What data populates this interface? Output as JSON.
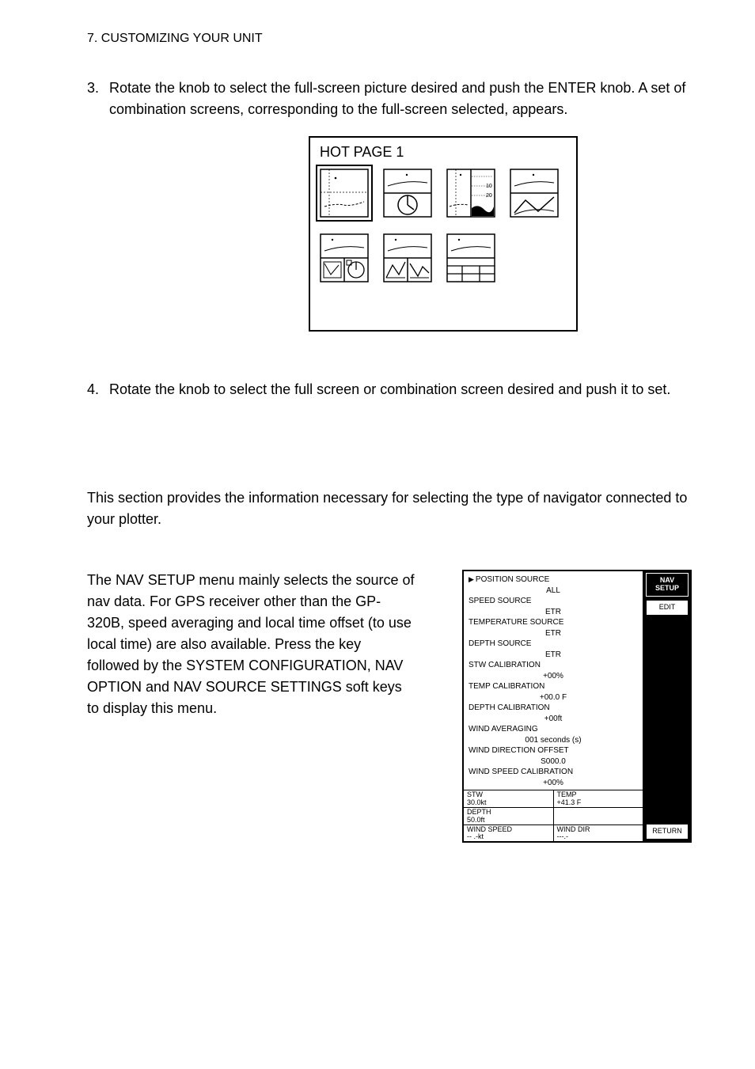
{
  "header": "7. CUSTOMIZING YOUR UNIT",
  "step3": {
    "num": "3.",
    "text": "Rotate the             knob to select the full-screen picture desired and push the ENTER knob. A set of combination screens, corresponding to the full-screen selected, appears."
  },
  "hotpage": {
    "title": "HOT PAGE 1",
    "thumb3_labels": {
      "ten": "10",
      "twenty": "20"
    }
  },
  "step4": {
    "num": "4.",
    "text": "Rotate the             knob to select the full screen or combination screen desired and push it to set."
  },
  "section_intro": "This section provides the information necessary for selecting the type of navigator connected to your plotter.",
  "nav_text": "The NAV SETUP menu mainly selects the source of nav data. For GPS receiver other than the GP-320B, speed averaging and local time offset (to use local time) are also available. Press the          key followed by the SYSTEM CONFIGURATION, NAV OPTION and NAV SOURCE SETTINGS soft keys to display this menu.",
  "nav_panel": {
    "items": [
      {
        "label": "POSITION SOURCE",
        "value": "ALL",
        "pointer": true
      },
      {
        "label": "SPEED SOURCE",
        "value": "ETR"
      },
      {
        "label": "TEMPERATURE SOURCE",
        "value": "ETR"
      },
      {
        "label": "DEPTH SOURCE",
        "value": "ETR"
      },
      {
        "label": "STW CALIBRATION",
        "value": "+00%"
      },
      {
        "label": "TEMP CALIBRATION",
        "value": "+00.0 F"
      },
      {
        "label": "DEPTH CALIBRATION",
        "value": "+00ft"
      },
      {
        "label": "WIND AVERAGING",
        "value": "001 seconds (s)"
      },
      {
        "label": "WIND DIRECTION OFFSET",
        "value": "S000.0"
      },
      {
        "label": "WIND SPEED CALIBRATION",
        "value": "+00%"
      }
    ],
    "table": [
      [
        {
          "label": "STW",
          "value": "30.0kt"
        },
        {
          "label": "TEMP",
          "value": "+41.3 F"
        }
      ],
      [
        {
          "label": "DEPTH",
          "value": "50.0ft"
        },
        {
          "label": "",
          "value": ""
        }
      ],
      [
        {
          "label": "WIND SPEED",
          "value": "-- .-kt"
        },
        {
          "label": "WIND DIR",
          "value": "---.-"
        }
      ]
    ],
    "soft": {
      "title1": "NAV",
      "title2": "SETUP",
      "edit": "EDIT",
      "return": "RETURN"
    }
  }
}
